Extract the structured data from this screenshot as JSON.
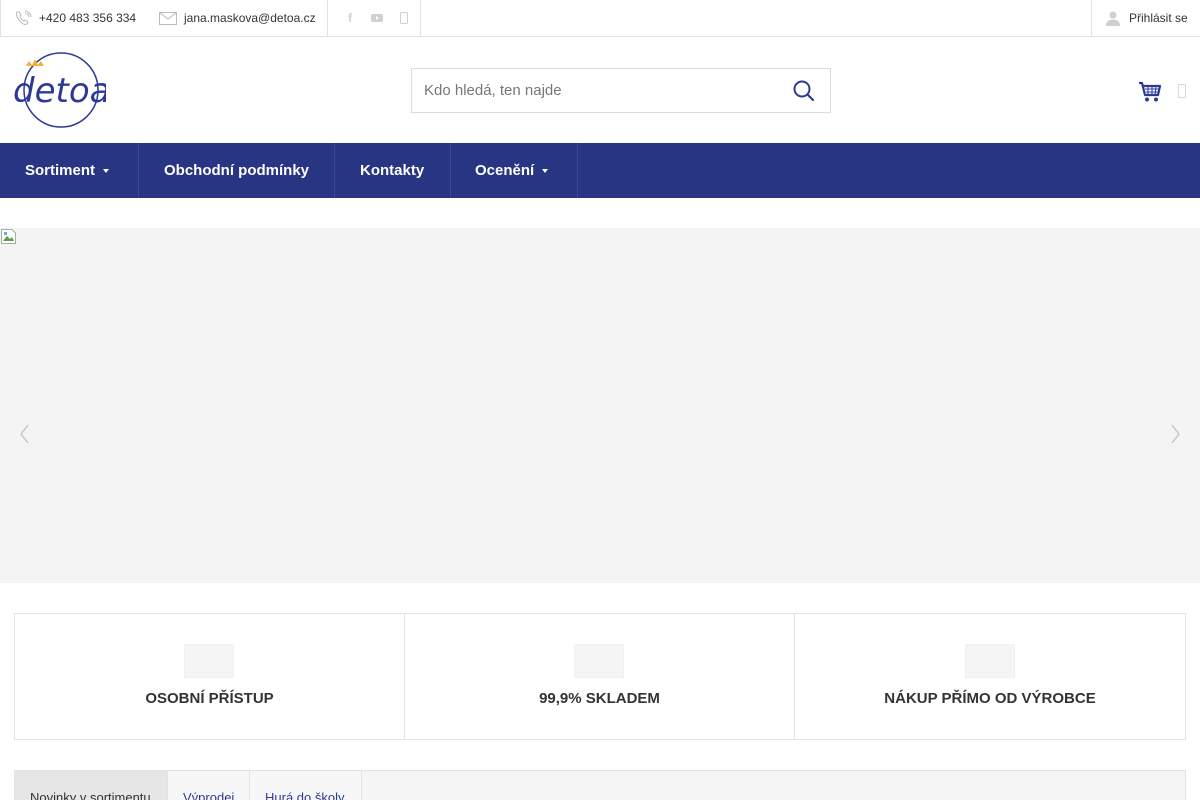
{
  "topbar": {
    "phone": "+420 483 356 334",
    "email": "jana.maskova@detoa.cz",
    "social": [
      "facebook-icon",
      "youtube-icon",
      "instagram-icon"
    ],
    "login_label": "Přihlásit se"
  },
  "logo": {
    "text": "detoa"
  },
  "search": {
    "placeholder": "Kdo hledá, ten najde"
  },
  "nav": {
    "items": [
      {
        "label": "Sortiment",
        "has_dropdown": true
      },
      {
        "label": "Obchodní podmínky",
        "has_dropdown": false
      },
      {
        "label": "Kontakty",
        "has_dropdown": false
      },
      {
        "label": "Ocenění",
        "has_dropdown": true
      }
    ]
  },
  "features": [
    {
      "label": "OSOBNÍ PŘÍSTUP"
    },
    {
      "label": "99,9% SKLADEM"
    },
    {
      "label": "NÁKUP PŘÍMO OD VÝROBCE"
    }
  ],
  "tabs": [
    {
      "label": "Novinky v sortimentu",
      "active": true
    },
    {
      "label": "Výprodej",
      "active": false
    },
    {
      "label": "Hurá do školy",
      "active": false
    }
  ],
  "colors": {
    "nav_bg": "#283582",
    "brand": "#2c3a96",
    "logo_crown": "#f2b134"
  }
}
